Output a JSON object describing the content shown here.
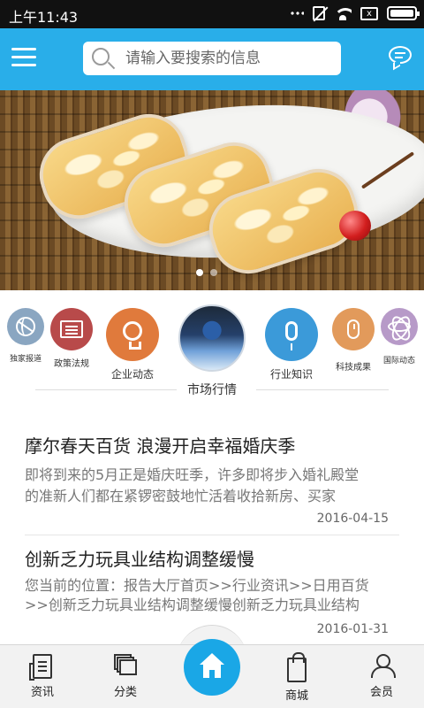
{
  "status_bar": {
    "time": "上午11:43"
  },
  "header": {
    "search_placeholder": "请输入要搜索的信息"
  },
  "banner": {
    "slide_count": 2,
    "active_slide": 1
  },
  "categories": [
    {
      "label": "独家报道",
      "icon": "basketball-icon",
      "color": "#8aa6c1"
    },
    {
      "label": "政策法规",
      "icon": "document-icon",
      "color": "#b84a4a"
    },
    {
      "label": "企业动态",
      "icon": "lightbulb-icon",
      "color": "#e07a3c"
    },
    {
      "label": "市场行情",
      "icon": "backpack-photo",
      "color": "#2b5fa8"
    },
    {
      "label": "行业知识",
      "icon": "microphone-icon",
      "color": "#3b9ad9"
    },
    {
      "label": "科技成果",
      "icon": "mouse-icon",
      "color": "#e29a5b"
    },
    {
      "label": "国际动态",
      "icon": "atom-icon",
      "color": "#b79ac8"
    }
  ],
  "news": [
    {
      "title": "摩尔春天百货 浪漫开启幸福婚庆季",
      "summary_line1": "即将到来的5月正是婚庆旺季，许多即将步入婚礼殿堂",
      "summary_line2": "的准新人们都在紧锣密鼓地忙活着收拾新房、买家",
      "date": "2016-04-15"
    },
    {
      "title": "创新乏力玩具业结构调整缓慢",
      "summary_line1": "您当前的位置：报告大厅首页>>行业资讯>>日用百货",
      "summary_line2": ">>创新乏力玩具业结构调整缓慢创新乏力玩具业结构",
      "date": "2016-01-31"
    }
  ],
  "tabbar": {
    "news": "资讯",
    "category": "分类",
    "shop": "商城",
    "member": "会员"
  }
}
